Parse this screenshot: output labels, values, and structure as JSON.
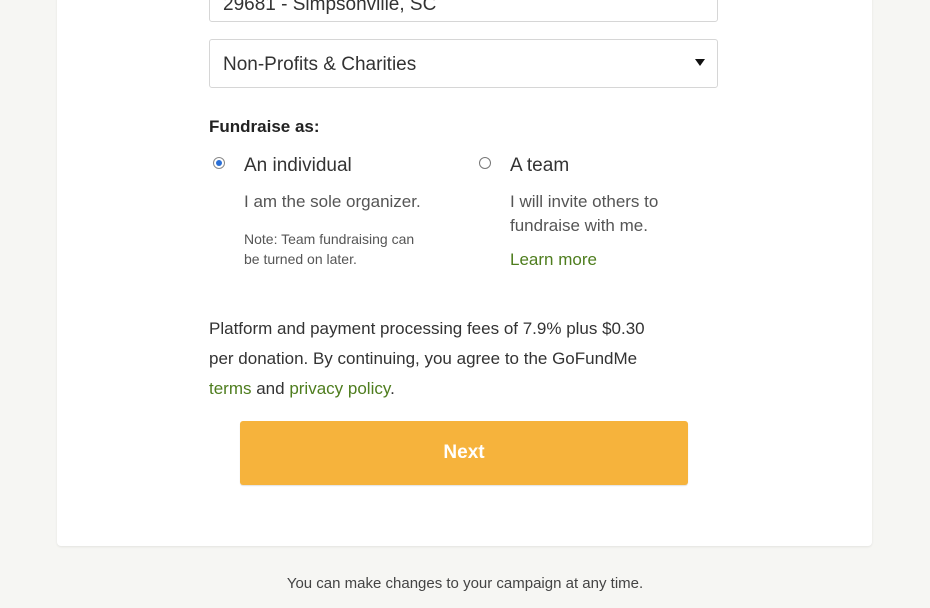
{
  "form": {
    "location_value": "29681 - Simpsonville, SC",
    "category_value": "Non-Profits & Charities",
    "fundraise_heading": "Fundraise as:",
    "options": [
      {
        "label": "An individual",
        "selected": true,
        "description": "I am the sole organizer.",
        "note_line1": "Note: Team fundraising can",
        "note_line2": "be turned on later."
      },
      {
        "label": "A team",
        "selected": false,
        "description_line1": "I will invite others to",
        "description_line2": "fundraise with me.",
        "link": "Learn more"
      }
    ],
    "fees_line1": "Platform and payment processing fees of 7.9% plus $0.30",
    "fees_line2": "per donation. By continuing, you agree to the GoFundMe",
    "terms_link": "terms",
    "and_text": " and ",
    "privacy_link": "privacy policy",
    "period": ".",
    "next_label": "Next"
  },
  "footer": {
    "note": "You can make changes to your campaign at any time."
  },
  "colors": {
    "button": "#f6b33c",
    "link": "#4e7d1e",
    "radio_selected": "#2a6fd6"
  }
}
